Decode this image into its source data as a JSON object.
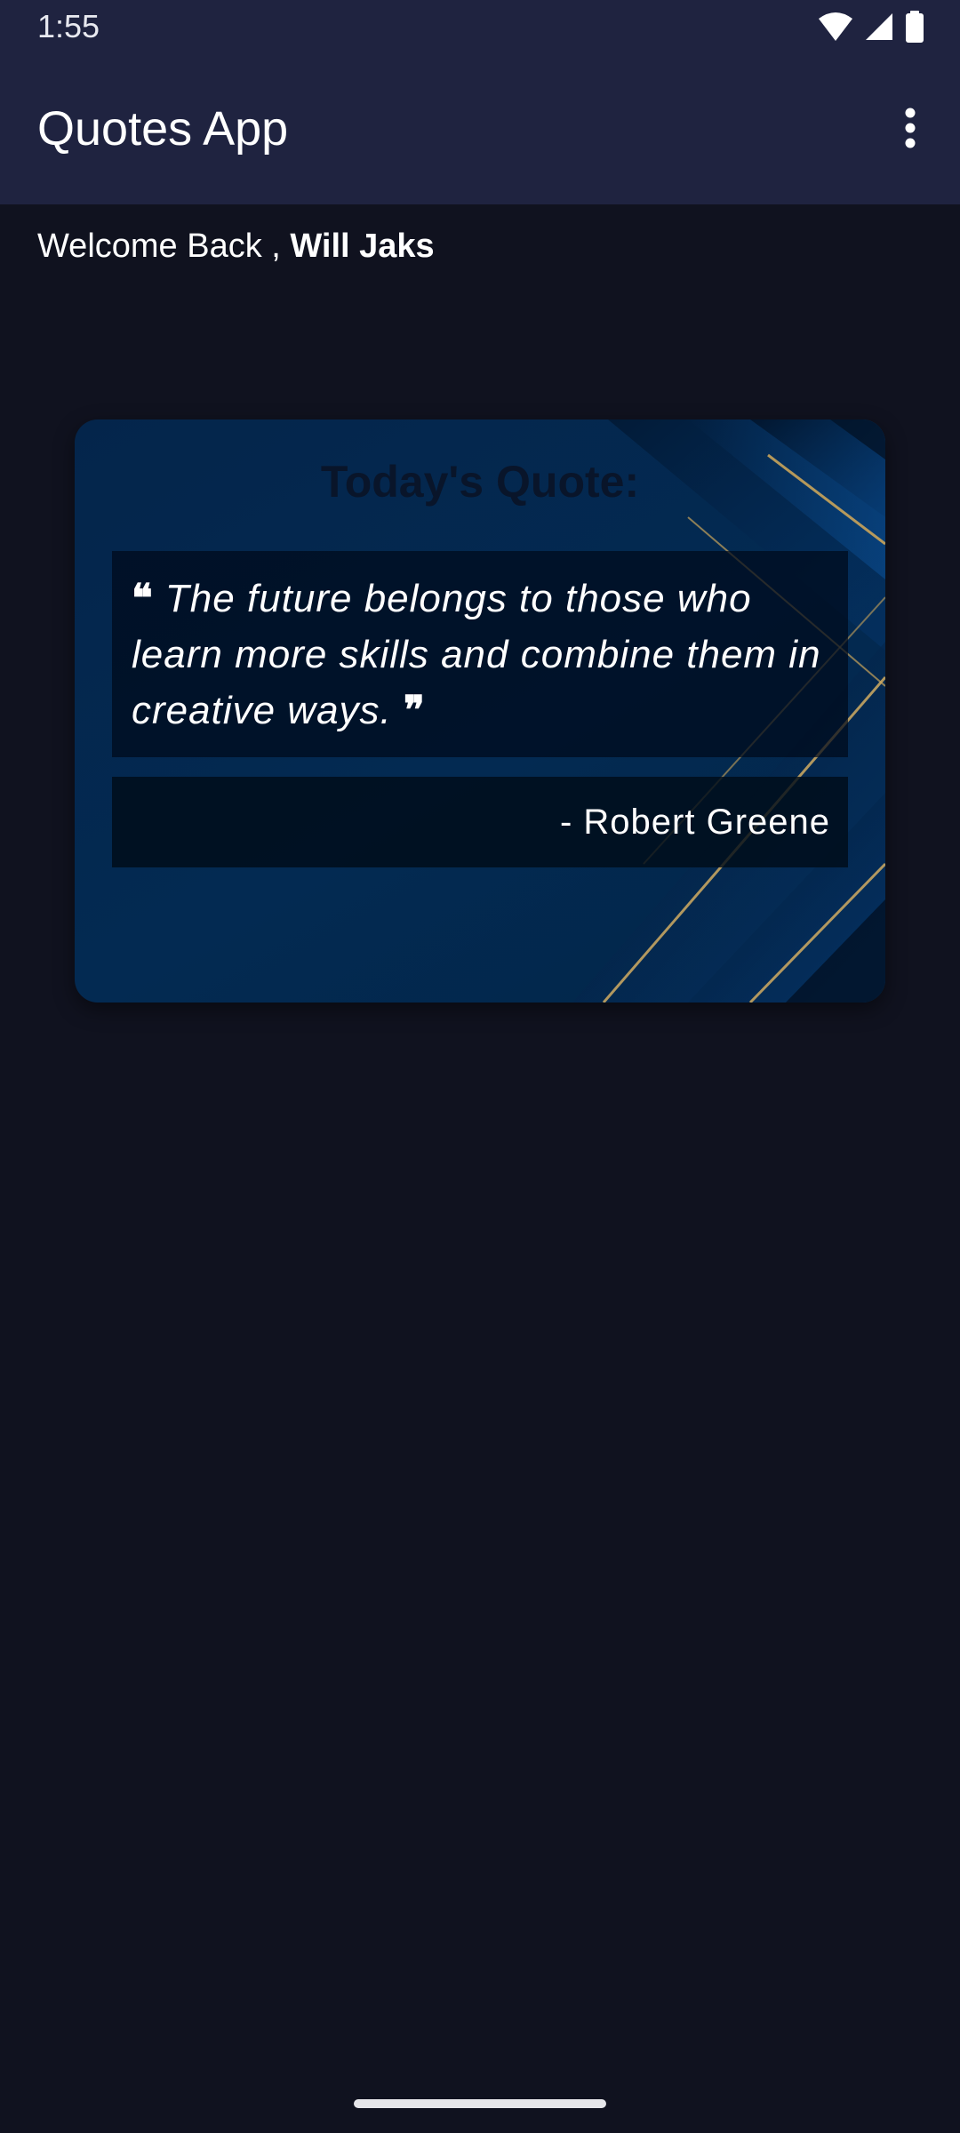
{
  "status_bar": {
    "time": "1:55",
    "icons": [
      "wifi-icon",
      "signal-icon",
      "battery-icon"
    ]
  },
  "app_bar": {
    "title": "Quotes App",
    "menu_icon": "more-vert-icon"
  },
  "welcome": {
    "prefix": "Welcome Back , ",
    "user_name": "Will Jaks"
  },
  "quote_card": {
    "title": "Today's Quote:",
    "open_quote": "❝",
    "quote": "The future belongs to those who learn more skills and combine them in creative ways.",
    "close_quote": "❞",
    "author": "- Robert Greene"
  },
  "colors": {
    "app_bar": "#1f2340",
    "background": "#10121f",
    "card": "#032a52",
    "accent_gold": "#c9a45a"
  }
}
